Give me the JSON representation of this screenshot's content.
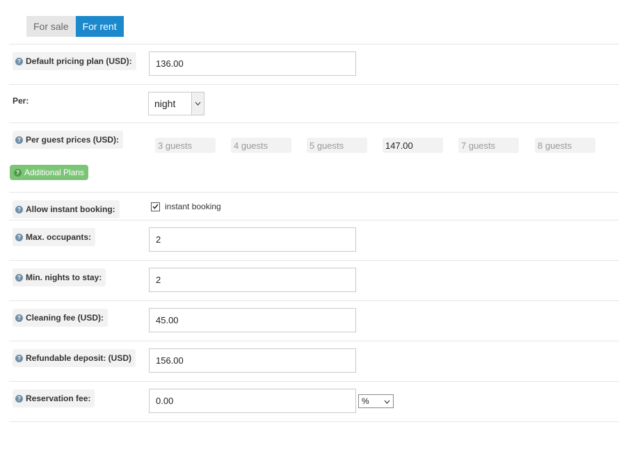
{
  "tabs": [
    {
      "label": "For sale",
      "active": false
    },
    {
      "label": "For rent",
      "active": true
    }
  ],
  "fields": {
    "default_pricing": {
      "label": "Default pricing plan (USD):",
      "value": "136.00"
    },
    "per": {
      "label": "Per:",
      "selected": "night"
    },
    "per_guest": {
      "label": "Per guest prices (USD):",
      "guests": [
        {
          "placeholder": "3 guests",
          "value": ""
        },
        {
          "placeholder": "4 guests",
          "value": ""
        },
        {
          "placeholder": "5 guests",
          "value": ""
        },
        {
          "placeholder": "",
          "value": "147.00"
        },
        {
          "placeholder": "7 guests",
          "value": ""
        },
        {
          "placeholder": "8 guests",
          "value": ""
        }
      ]
    },
    "additional_plans": {
      "label": "Additional Plans"
    },
    "instant_booking": {
      "label": "Allow instant booking:",
      "checkbox_label": "instant booking",
      "checked": true
    },
    "max_occupants": {
      "label": "Max. occupants:",
      "value": "2"
    },
    "min_nights": {
      "label": "Min. nights to stay:",
      "value": "2"
    },
    "cleaning_fee": {
      "label": "Cleaning fee (USD):",
      "value": "45.00"
    },
    "refundable_deposit": {
      "label": "Refundable deposit: (USD)",
      "value": "156.00"
    },
    "reservation_fee": {
      "label": "Reservation fee:",
      "value": "0.00",
      "unit": "%"
    }
  },
  "icons": {
    "help": "question-mark-icon",
    "check": "check-icon",
    "dropdown": "chevron-down-icon"
  },
  "colors": {
    "tab_active": "#1b89cc",
    "button_green": "#7cc576",
    "help_icon": "#6f8fa6"
  }
}
